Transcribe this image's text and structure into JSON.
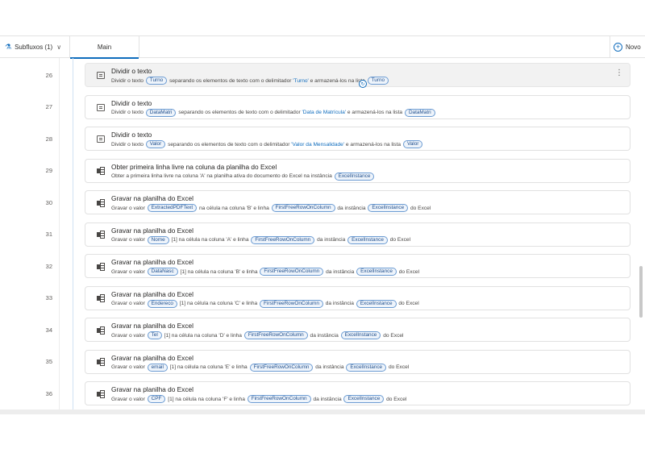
{
  "header": {
    "subflows_label": "Subfluxos (1)",
    "main_tab_label": "Main",
    "new_label": "Novo"
  },
  "actions": [
    {
      "line": "26",
      "title": "Dividir o texto",
      "icon": "text-icon",
      "selected": true,
      "parts": [
        {
          "t": "Dividir o texto "
        },
        {
          "v": "Turno"
        },
        {
          "t": " separando os elementos de texto com o delimitador "
        },
        {
          "l": "'Turno'"
        },
        {
          "t": " e armazená-los na lista "
        },
        {
          "v": "Turno"
        }
      ]
    },
    {
      "line": "27",
      "title": "Dividir o texto",
      "icon": "text-icon",
      "parts": [
        {
          "t": "Dividir o texto "
        },
        {
          "v": "DataMatri"
        },
        {
          "t": " separando os elementos de texto com o delimitador "
        },
        {
          "l": "'Data de Matrícula'"
        },
        {
          "t": " e armazená-los na lista "
        },
        {
          "v": "DataMatri"
        }
      ]
    },
    {
      "line": "28",
      "title": "Dividir o texto",
      "icon": "text-icon",
      "parts": [
        {
          "t": "Dividir o texto "
        },
        {
          "v": "Valor"
        },
        {
          "t": " separando os elementos de texto com o delimitador "
        },
        {
          "l": "'Valor da Mensalidade'"
        },
        {
          "t": " e armazená-los na lista "
        },
        {
          "v": "Valor"
        }
      ]
    },
    {
      "line": "29",
      "title": "Obter primeira linha livre na coluna da planilha do Excel",
      "icon": "excel-icon",
      "parts": [
        {
          "t": "Obter a primeira linha livre na coluna 'A' na planilha ativa do documento do Excel na instância "
        },
        {
          "v": "ExcelInstance"
        }
      ]
    },
    {
      "line": "30",
      "title": "Gravar na planilha do Excel",
      "icon": "excel-icon",
      "parts": [
        {
          "t": "Gravar o valor "
        },
        {
          "v": "ExtractedPDFText"
        },
        {
          "t": " na célula na coluna 'B' e linha "
        },
        {
          "v": "FirstFreeRowOnColumn"
        },
        {
          "t": " da instância "
        },
        {
          "v": "ExcelInstance"
        },
        {
          "t": " do Excel"
        }
      ]
    },
    {
      "line": "31",
      "title": "Gravar na planilha do Excel",
      "icon": "excel-icon",
      "parts": [
        {
          "t": "Gravar o valor "
        },
        {
          "v": "Nome"
        },
        {
          "t": " [1] na célula na coluna 'A' e linha "
        },
        {
          "v": "FirstFreeRowOnColumn"
        },
        {
          "t": " da instância "
        },
        {
          "v": "ExcelInstance"
        },
        {
          "t": " do Excel"
        }
      ]
    },
    {
      "line": "32",
      "title": "Gravar na planilha do Excel",
      "icon": "excel-icon",
      "parts": [
        {
          "t": "Gravar o valor "
        },
        {
          "v": "DataNasc"
        },
        {
          "t": " [1] na célula na coluna 'B' e linha "
        },
        {
          "v": "FirstFreeRowOnColumn"
        },
        {
          "t": " da instância "
        },
        {
          "v": "ExcelInstance"
        },
        {
          "t": " do Excel"
        }
      ]
    },
    {
      "line": "33",
      "title": "Gravar na planilha do Excel",
      "icon": "excel-icon",
      "parts": [
        {
          "t": "Gravar o valor "
        },
        {
          "v": "Endereco"
        },
        {
          "t": " [1] na célula na coluna 'C' e linha "
        },
        {
          "v": "FirstFreeRowOnColumn"
        },
        {
          "t": " da instância "
        },
        {
          "v": "ExcelInstance"
        },
        {
          "t": " do Excel"
        }
      ]
    },
    {
      "line": "34",
      "title": "Gravar na planilha do Excel",
      "icon": "excel-icon",
      "parts": [
        {
          "t": "Gravar o valor "
        },
        {
          "v": "Tel"
        },
        {
          "t": " [1] na célula na coluna 'D' e linha "
        },
        {
          "v": "FirstFreeRowOnColumn"
        },
        {
          "t": " da instância "
        },
        {
          "v": "ExcelInstance"
        },
        {
          "t": " do Excel"
        }
      ]
    },
    {
      "line": "35",
      "title": "Gravar na planilha do Excel",
      "icon": "excel-icon",
      "parts": [
        {
          "t": "Gravar o valor "
        },
        {
          "v": "email"
        },
        {
          "t": " [1] na célula na coluna 'E' e linha "
        },
        {
          "v": "FirstFreeRowOnColumn"
        },
        {
          "t": " da instância "
        },
        {
          "v": "ExcelInstance"
        },
        {
          "t": " do Excel"
        }
      ]
    },
    {
      "line": "36",
      "title": "Gravar na planilha do Excel",
      "icon": "excel-icon",
      "parts": [
        {
          "t": "Gravar o valor "
        },
        {
          "v": "CPF"
        },
        {
          "t": " [1] na célula na coluna 'F' e linha "
        },
        {
          "v": "FirstFreeRowOnColumn"
        },
        {
          "t": " da instância "
        },
        {
          "v": "ExcelInstance"
        },
        {
          "t": " do Excel"
        }
      ]
    }
  ],
  "colors": {
    "accent": "#0f6cbd",
    "variable_border": "#6b9bd2",
    "variable_bg": "#eef4fb"
  }
}
